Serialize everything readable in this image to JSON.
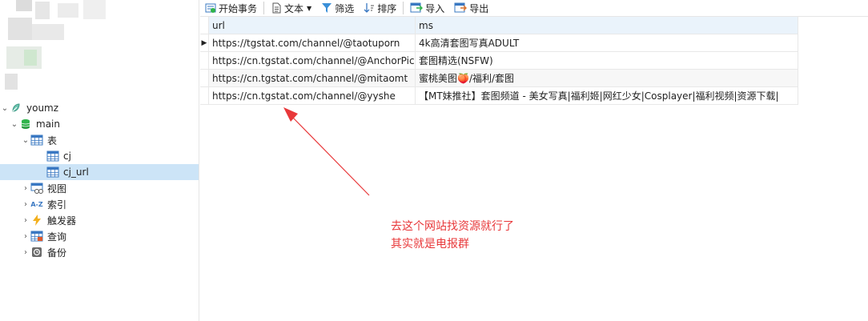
{
  "toolbar": {
    "begin_transaction": "开始事务",
    "text": "文本",
    "filter": "筛选",
    "sort": "排序",
    "import": "导入",
    "export": "导出"
  },
  "tree": {
    "connection": "youmz",
    "database": "main",
    "tables_group": "表",
    "tables": [
      "cj",
      "cj_url"
    ],
    "views": "视图",
    "indexes": "索引",
    "triggers": "触发器",
    "queries": "查询",
    "backups": "备份"
  },
  "grid": {
    "columns": [
      "url",
      "ms"
    ],
    "rows": [
      [
        "https://tgstat.com/channel/@taotuporn",
        "4k高清套图写真ADULT"
      ],
      [
        "https://cn.tgstat.com/channel/@AnchorPic",
        "套图精选(NSFW)"
      ],
      [
        "https://cn.tgstat.com/channel/@mitaomt",
        "蜜桃美图🍑/福利/套图"
      ],
      [
        "https://cn.tgstat.com/channel/@yyshe",
        "【MT妹推社】套图频道 - 美女写真|福利姬|网红少女|Cosplayer|福利视频|资源下载|"
      ]
    ]
  },
  "annotation": {
    "line1": "去这个网站找资源就行了",
    "line2": "其实就是电报群",
    "color": "#e8383a"
  }
}
